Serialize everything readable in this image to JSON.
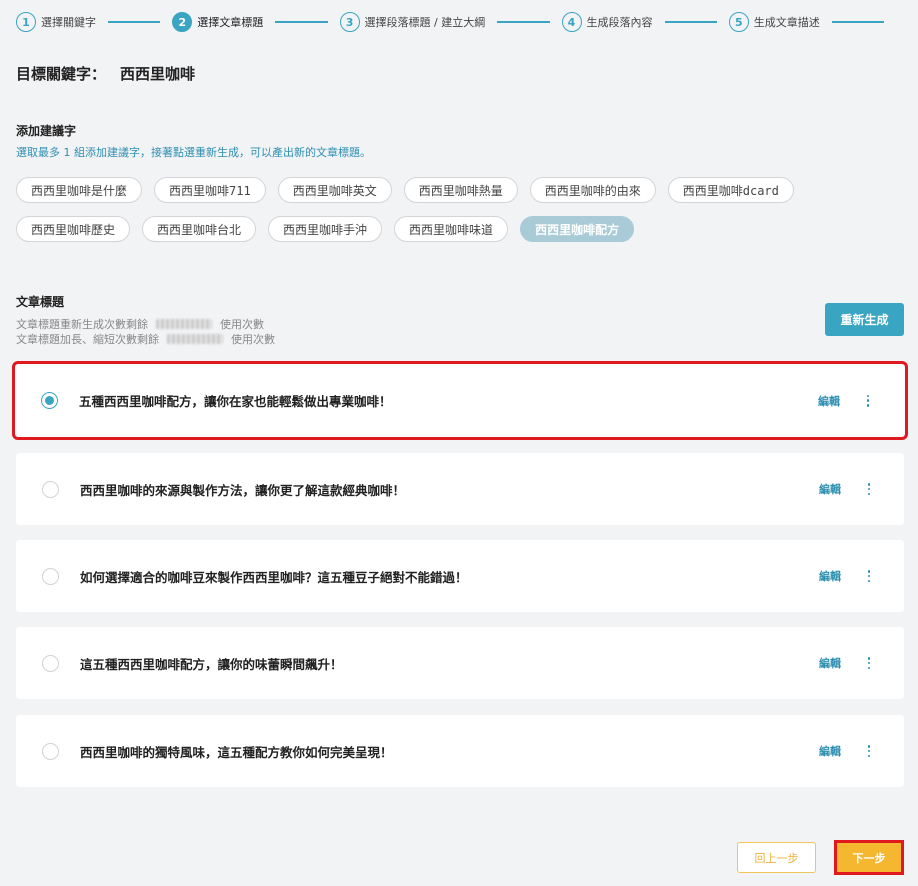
{
  "stepper": {
    "steps": [
      {
        "num": "1",
        "label": "選擇關鍵字",
        "active": false
      },
      {
        "num": "2",
        "label": "選擇文章標題",
        "active": true
      },
      {
        "num": "3",
        "label": "選擇段落標題 / 建立大綱",
        "active": false
      },
      {
        "num": "4",
        "label": "生成段落內容",
        "active": false
      },
      {
        "num": "5",
        "label": "生成文章描述",
        "active": false
      }
    ]
  },
  "target_keyword": {
    "label": "目標關鍵字：",
    "value": "西西里咖啡"
  },
  "suggestions": {
    "title": "添加建議字",
    "hint": "選取最多 1 組添加建議字，接著點選重新生成，可以產出新的文章標題。",
    "chips": [
      {
        "label": "西西里咖啡是什麼",
        "selected": false
      },
      {
        "label": "西西里咖啡711",
        "selected": false
      },
      {
        "label": "西西里咖啡英文",
        "selected": false
      },
      {
        "label": "西西里咖啡熱量",
        "selected": false
      },
      {
        "label": "西西里咖啡的由來",
        "selected": false
      },
      {
        "label": "西西里咖啡dcard",
        "selected": false
      },
      {
        "label": "西西里咖啡歷史",
        "selected": false
      },
      {
        "label": "西西里咖啡台北",
        "selected": false
      },
      {
        "label": "西西里咖啡手沖",
        "selected": false
      },
      {
        "label": "西西里咖啡味道",
        "selected": false
      },
      {
        "label": "西西里咖啡配方",
        "selected": true
      }
    ]
  },
  "titles_section": {
    "heading": "文章標題",
    "quota_regen_prefix": "文章標題重新生成次數剩餘",
    "quota_regen_suffix": "使用次數",
    "quota_length_prefix": "文章標題加長、縮短次數剩餘",
    "quota_length_suffix": "使用次數",
    "regen_button": "重新生成"
  },
  "titles": [
    {
      "text": "五種西西里咖啡配方，讓你在家也能輕鬆做出專業咖啡！",
      "selected": true,
      "edit": "編輯"
    },
    {
      "text": "西西里咖啡的來源與製作方法，讓你更了解這款經典咖啡！",
      "selected": false,
      "edit": "編輯"
    },
    {
      "text": "如何選擇適合的咖啡豆來製作西西里咖啡？這五種豆子絕對不能錯過！",
      "selected": false,
      "edit": "編輯"
    },
    {
      "text": "這五種西西里咖啡配方，讓你的味蕾瞬間飆升！",
      "selected": false,
      "edit": "編輯"
    },
    {
      "text": "西西里咖啡的獨特風味，這五種配方教你如何完美呈現！",
      "selected": false,
      "edit": "編輯"
    }
  ],
  "footer": {
    "prev_button": "回上一步",
    "next_button": "下一步"
  },
  "colors": {
    "accent": "#3aa5c2",
    "highlight": "#e0191e",
    "next": "#f5b630"
  }
}
